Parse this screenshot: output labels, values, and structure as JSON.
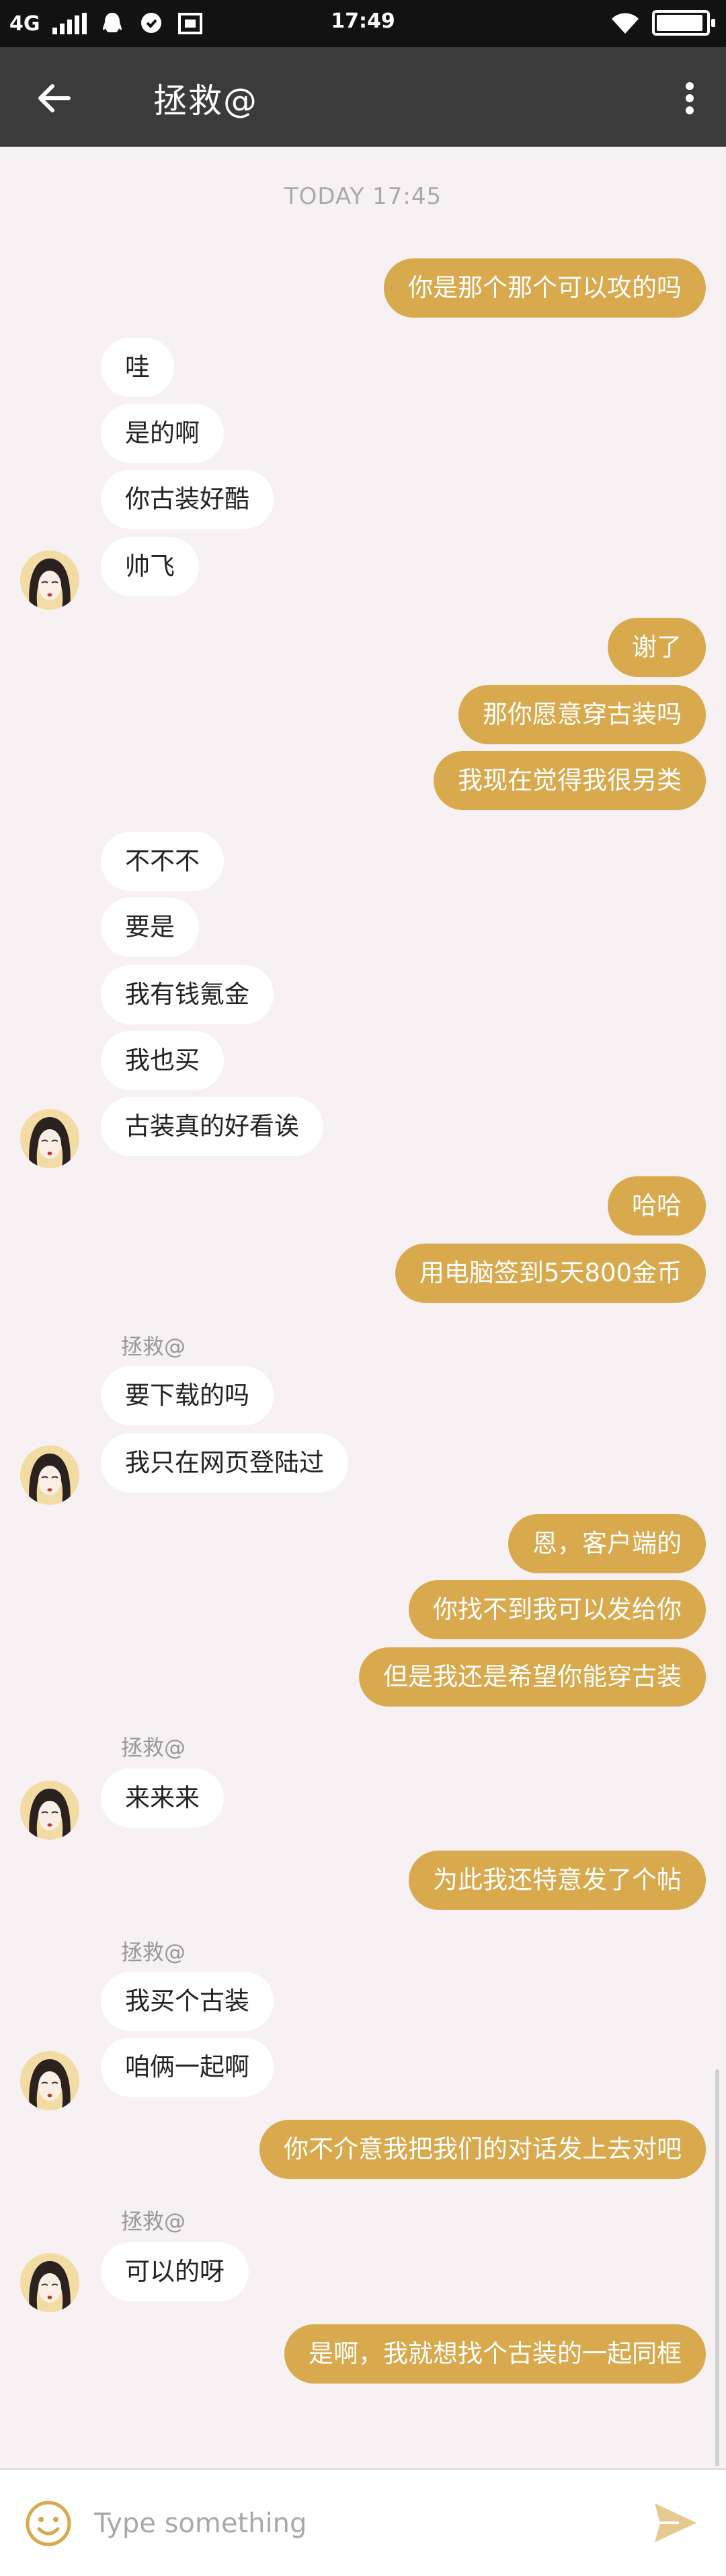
{
  "status_bar": {
    "network": "4G",
    "time": "17:49",
    "battery_level": 0.92
  },
  "header": {
    "title": "拯救@"
  },
  "chat": {
    "timestamp": "TODAY 17:45",
    "sender_name": "拯救@",
    "messages": [
      {
        "dir": "out",
        "text": "你是那个那个可以攻的吗"
      },
      {
        "dir": "in",
        "text": "哇"
      },
      {
        "dir": "in",
        "text": "是的啊"
      },
      {
        "dir": "in",
        "text": "你古装好酷"
      },
      {
        "dir": "in",
        "text": "帅飞"
      },
      {
        "dir": "out",
        "text": "谢了"
      },
      {
        "dir": "out",
        "text": "那你愿意穿古装吗"
      },
      {
        "dir": "out",
        "text": "我现在觉得我很另类"
      },
      {
        "dir": "in",
        "text": "不不不"
      },
      {
        "dir": "in",
        "text": "要是"
      },
      {
        "dir": "in",
        "text": "我有钱氪金"
      },
      {
        "dir": "in",
        "text": "我也买"
      },
      {
        "dir": "in",
        "text": "古装真的好看诶"
      },
      {
        "dir": "out",
        "text": "哈哈"
      },
      {
        "dir": "out",
        "text": "用电脑签到5天800金币"
      },
      {
        "dir": "in",
        "text": "要下载的吗"
      },
      {
        "dir": "in",
        "text": "我只在网页登陆过"
      },
      {
        "dir": "out",
        "text": "恩，客户端的"
      },
      {
        "dir": "out",
        "text": "你找不到我可以发给你"
      },
      {
        "dir": "out",
        "text": "但是我还是希望你能穿古装"
      },
      {
        "dir": "in",
        "text": "来来来"
      },
      {
        "dir": "out",
        "text": "为此我还特意发了个帖"
      },
      {
        "dir": "in",
        "text": "我买个古装"
      },
      {
        "dir": "in",
        "text": "咱俩一起啊"
      },
      {
        "dir": "out",
        "text": "你不介意我把我们的对话发上去对吧"
      },
      {
        "dir": "in",
        "text": "可以的呀"
      },
      {
        "dir": "out",
        "text": "是啊，我就想找个古装的一起同框"
      }
    ]
  },
  "input_bar": {
    "placeholder": "Type something"
  },
  "icons": {
    "back": "arrow-left-icon",
    "menu": "more-vertical-icon",
    "emoji": "smiley-icon",
    "send": "send-icon"
  },
  "colors": {
    "outgoing_bubble": "#d9a94e",
    "incoming_bubble": "#ffffff",
    "header": "#3b3b3b",
    "background": "#f7f1f4"
  }
}
